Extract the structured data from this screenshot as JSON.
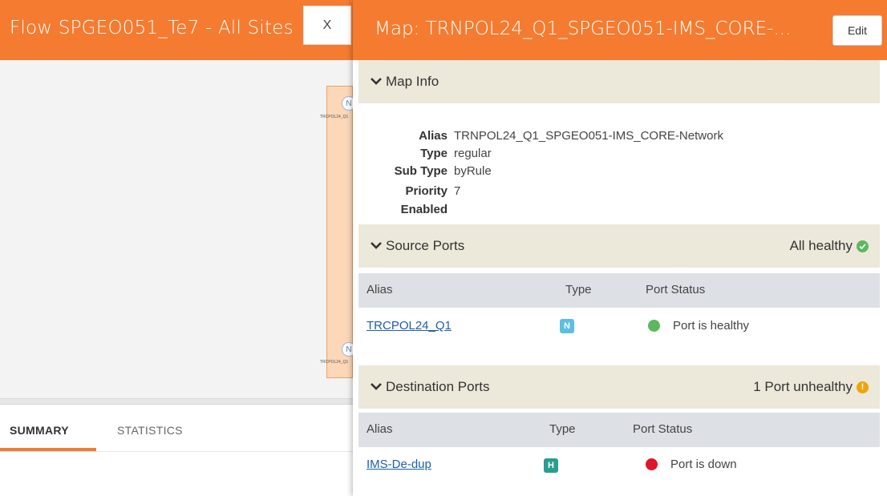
{
  "background": {
    "title": "Flow SPGEO051_Te7 - All Sites",
    "close_label": "X",
    "node": {
      "badge": "N",
      "text_top": "TRCPOL24_Q1",
      "text_bottom": "TRCPOL24_Q1"
    },
    "tabs": [
      {
        "label": "SUMMARY",
        "active": true
      },
      {
        "label": "STATISTICS",
        "active": false
      }
    ]
  },
  "panel": {
    "title": "Map: TRNPOL24_Q1_SPGEO051-IMS_CORE-...",
    "edit_label": "Edit",
    "map_info": {
      "heading": "Map Info",
      "rows": [
        {
          "key": "Alias",
          "value": "TRNPOL24_Q1_SPGEO051-IMS_CORE-Network"
        },
        {
          "key": "Type",
          "value": "regular"
        },
        {
          "key": "Sub Type",
          "value": "byRule"
        },
        {
          "key": "Priority",
          "value": "7"
        },
        {
          "key": "Enabled",
          "value": ""
        }
      ]
    },
    "source_ports": {
      "heading": "Source Ports",
      "status": "All healthy",
      "columns": [
        "Alias",
        "Type",
        "Port Status"
      ],
      "rows": [
        {
          "alias": "TRCPOL24_Q1",
          "type": "N",
          "status": "Port is healthy"
        }
      ]
    },
    "destination_ports": {
      "heading": "Destination Ports",
      "status": "1 Port unhealthy",
      "columns": [
        "Alias",
        "Type",
        "Port Status"
      ],
      "rows": [
        {
          "alias": "IMS-De-dup",
          "type": "H",
          "status": "Port is down"
        }
      ]
    }
  },
  "colors": {
    "accent": "#f47b30",
    "healthy": "#5cb85c",
    "down": "#e0142b",
    "warning": "#f0a30a",
    "type_n": "#5bc0de",
    "type_h": "#2a9d8f",
    "section_bg": "#ece8da",
    "table_head_bg": "#dde0e5"
  }
}
